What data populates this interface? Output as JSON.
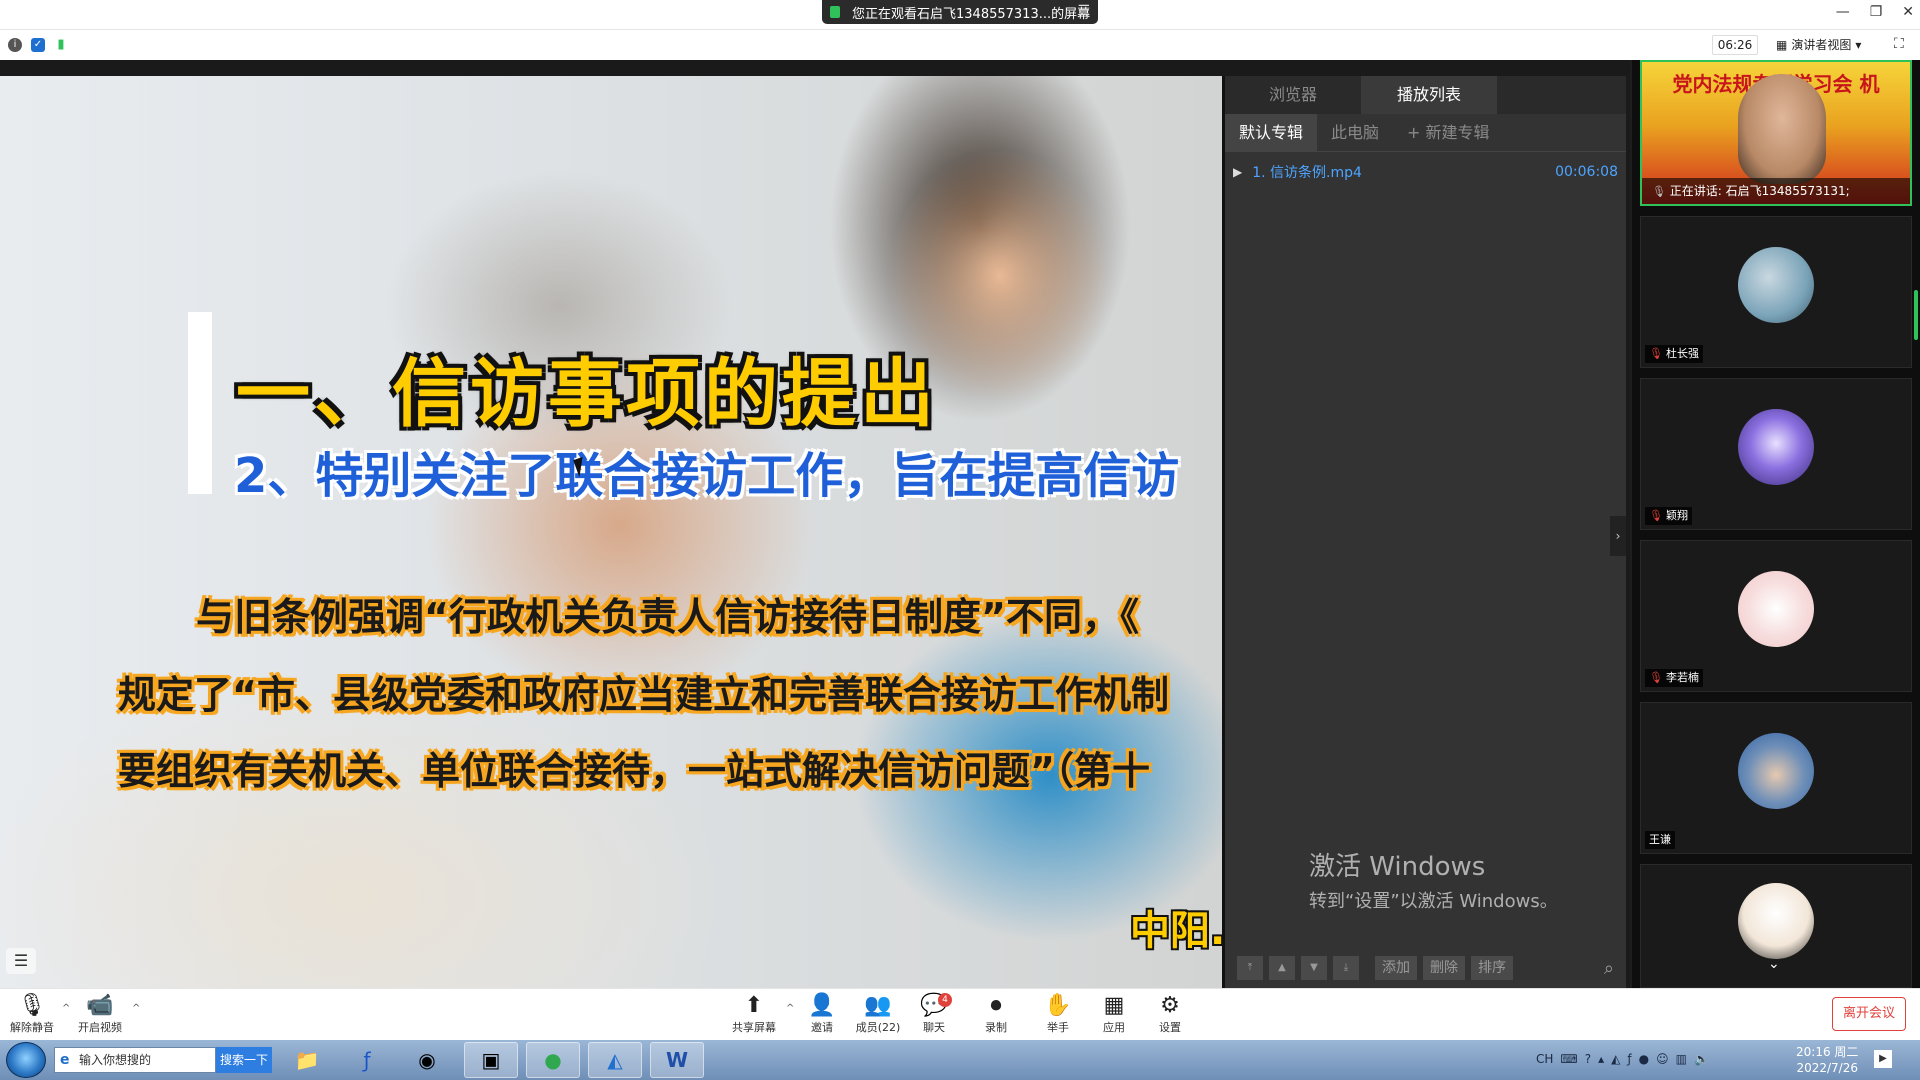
{
  "window": {
    "share_banner": "您正在观看石启飞1348557313...的屏幕",
    "controls": [
      "—",
      "❐",
      "✕"
    ]
  },
  "infobar": {
    "timer": "06:26",
    "view_mode": "演讲者视图"
  },
  "slide": {
    "heading": "一、信访事项的提出",
    "subheading": "2、特别关注了联合接访工作，旨在提高信访",
    "body_lines": [
      "与旧条例强调“行政机关负责人信访接待日制度”不同，《",
      "规定了“市、县级党委和政府应当建立和完善联合接访工作机制",
      "要组织有关机关、单位联合接待，一站式解决信访问题”（第十"
    ],
    "logo": "中阳."
  },
  "playlist": {
    "tabs": [
      "浏览器",
      "播放列表"
    ],
    "albums": [
      "默认专辑",
      "此电脑",
      "+ 新建专辑"
    ],
    "items": [
      {
        "name": "1. 信访条例.mp4",
        "duration": "00:06:08"
      }
    ],
    "watermark_line1": "激活 Windows",
    "watermark_line2": "转到“设置”以激活 Windows。",
    "footer_buttons": [
      "添加",
      "删除",
      "排序"
    ]
  },
  "participants": {
    "speaker_banner": "党内法规专题学习会 机",
    "speaker_caption": "正在讲话: 石启飞13485573131;",
    "tiles": [
      {
        "name": "杜长强",
        "muted": true,
        "avatar_color": "#7aa3b8"
      },
      {
        "name": "颖翔",
        "muted": true,
        "avatar_color": "#3a2b75"
      },
      {
        "name": "李若楠",
        "muted": true,
        "avatar_color": "#f2c8c8"
      },
      {
        "name": "王谦",
        "muted": false,
        "avatar_color": "#2f63a6"
      },
      {
        "name": "",
        "muted": false,
        "avatar_color": "#ffffff"
      }
    ]
  },
  "toolbar": {
    "unmute": "解除静音",
    "start_video": "开启视频",
    "share_screen": "共享屏幕",
    "invite": "邀请",
    "members": "成员(22)",
    "chat": "聊天",
    "chat_badge": "4",
    "record": "录制",
    "raise_hand": "举手",
    "apps": "应用",
    "settings": "设置",
    "leave": "离开会议"
  },
  "taskbar": {
    "search_placeholder": "输入你想搜的",
    "search_button": "搜索一下",
    "tray_lang": "CH",
    "time": "20:16 周二",
    "date": "2022/7/26"
  },
  "colors": {
    "accent_green": "#2fc25b",
    "danger_red": "#e0413b",
    "link_blue": "#4ea4ff"
  }
}
